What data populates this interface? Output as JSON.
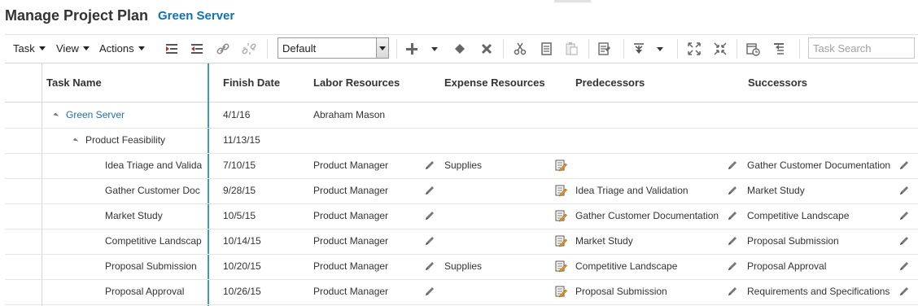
{
  "header": {
    "title": "Manage Project Plan",
    "subtitle": "Green Server"
  },
  "toolbar": {
    "menus": [
      {
        "label": "Task"
      },
      {
        "label": "View"
      },
      {
        "label": "Actions"
      }
    ],
    "layout_select": {
      "value": "Default"
    },
    "search": {
      "placeholder": "Task Search"
    }
  },
  "grid": {
    "columns": [
      {
        "label": "Task Name"
      },
      {
        "label": "Finish Date"
      },
      {
        "label": "Labor Resources"
      },
      {
        "label": "Expense Resources"
      },
      {
        "label": "Predecessors"
      },
      {
        "label": "Successors"
      }
    ],
    "rows": [
      {
        "task": "Green Server",
        "finish": "4/1/16",
        "labor": "Abraham Mason",
        "expense": "",
        "predecessors": "",
        "successors": "",
        "editable": false
      },
      {
        "task": "Product Feasibility",
        "finish": "11/13/15",
        "labor": "",
        "expense": "",
        "predecessors": "",
        "successors": "",
        "editable": false
      },
      {
        "task": "Idea Triage and Valida",
        "finish": "7/10/15",
        "labor": "Product Manager",
        "expense": "Supplies",
        "predecessors": "",
        "successors": "Gather Customer Documentation",
        "editable": true
      },
      {
        "task": "Gather Customer Doc",
        "finish": "9/28/15",
        "labor": "Product Manager",
        "expense": "",
        "predecessors": "Idea Triage and Validation",
        "successors": "Market Study",
        "editable": true
      },
      {
        "task": "Market Study",
        "finish": "10/5/15",
        "labor": "Product Manager",
        "expense": "",
        "predecessors": "Gather Customer Documentation",
        "successors": "Competitive Landscape",
        "editable": true
      },
      {
        "task": "Competitive Landscap",
        "finish": "10/14/15",
        "labor": "Product Manager",
        "expense": "",
        "predecessors": "Market Study",
        "successors": "Proposal Submission",
        "editable": true
      },
      {
        "task": "Proposal Submission",
        "finish": "10/20/15",
        "labor": "Product Manager",
        "expense": "Supplies",
        "predecessors": "Competitive Landscape",
        "successors": "Proposal Approval",
        "editable": true
      },
      {
        "task": "Proposal Approval",
        "finish": "10/26/15",
        "labor": "Product Manager",
        "expense": "",
        "predecessors": "Proposal Submission",
        "successors": "Requirements and Specifications",
        "editable": true
      }
    ]
  }
}
